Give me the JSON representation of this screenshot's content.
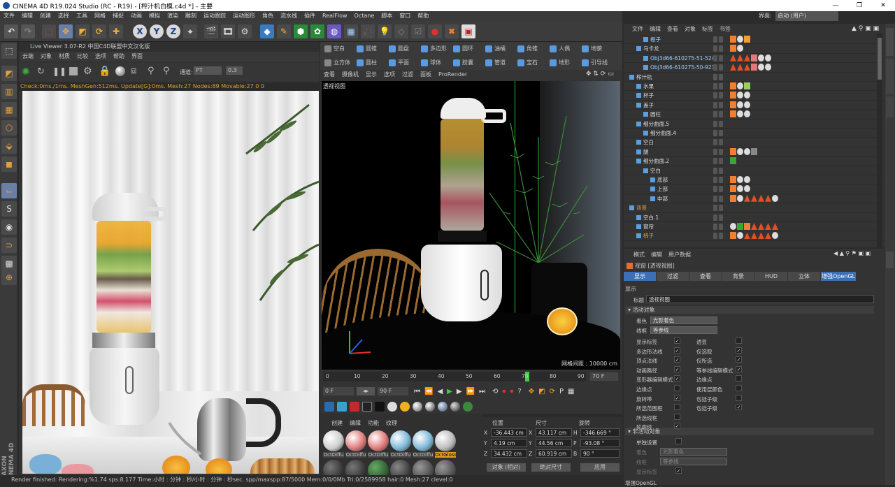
{
  "window": {
    "title": "CINEMA 4D R19.024 Studio (RC - R19) - [榨汁机白模.c4d *] - 主要",
    "layout_label": "界面:",
    "layout_value": "启动 (用户)"
  },
  "menu": [
    "文件",
    "编辑",
    "创建",
    "选择",
    "工具",
    "网格",
    "捕捉",
    "动画",
    "模拟",
    "渲染",
    "雕刻",
    "运动跟踪",
    "运动图形",
    "角色",
    "流水线",
    "插件",
    "RealFlow",
    "Octane",
    "脚本",
    "窗口",
    "帮助"
  ],
  "liveviewer": {
    "title": "Live Viewer 3.07-R2 中国C4D联盟中文汉化版",
    "menu": [
      "云端",
      "对象",
      "材质",
      "比较",
      "选项",
      "帮助",
      "界面"
    ],
    "channel_label": "通道:",
    "channel_value": "PT",
    "value_field": "0.3",
    "status": "Check:0ms./1ms. MeshGen:512ms. Update[G]:0ms. Mesh:27 Nodes:89 Movable:27  0 0"
  },
  "viewport": {
    "toolbar_row1": [
      "空白",
      "圆锥",
      "圆盘",
      "多边形",
      "圆环",
      "油桶",
      "角锥",
      "人偶",
      "地貌"
    ],
    "toolbar_row2": [
      "立方体",
      "圆柱",
      "平面",
      "球体",
      "胶囊",
      "管道",
      "宝石",
      "地形",
      "引导线"
    ],
    "menu": [
      "查看",
      "摄像机",
      "显示",
      "选项",
      "过滤",
      "面板",
      "ProRender"
    ],
    "label": "透视视图",
    "grid_distance": "网格间距 : 10000 cm"
  },
  "timeline": {
    "ticks": [
      "0",
      "10",
      "20",
      "30",
      "40",
      "50",
      "60",
      "70",
      "80",
      "90"
    ],
    "current": "70",
    "fps_field": "70 F",
    "start_field": "0 F",
    "end_field": "90 F"
  },
  "materials": {
    "menu": [
      "创建",
      "编辑",
      "功能",
      "纹理"
    ],
    "items": [
      {
        "label": "OctDiffu",
        "color": "#cfcfcf"
      },
      {
        "label": "OctDiffu",
        "color": "#e07b7b"
      },
      {
        "label": "OctDiffu",
        "color": "#e07b7b"
      },
      {
        "label": "OctDiffu",
        "color": "#7fb8d8"
      },
      {
        "label": "OctDiffu",
        "color": "#7fb8d8"
      },
      {
        "label": "OctGloss",
        "color": "#bcbcbc"
      }
    ]
  },
  "coords": {
    "headers": [
      "位置",
      "尺寸",
      "旋转"
    ],
    "rows": [
      {
        "axis": "X",
        "pos": "-36.443 cm",
        "size_axis": "X",
        "size": "43.117 cm",
        "rot_axis": "H",
        "rot": "-346.669 °"
      },
      {
        "axis": "Y",
        "pos": "4.19 cm",
        "size_axis": "Y",
        "size": "44.56 cm",
        "rot_axis": "P",
        "rot": "-93.08 °"
      },
      {
        "axis": "Z",
        "pos": "34.432 cm",
        "size_axis": "Z",
        "size": "60.919 cm",
        "rot_axis": "B",
        "rot": "90 °"
      }
    ],
    "mode1": "对象 (相对)",
    "mode2": "绝对尺寸",
    "apply": "应用"
  },
  "statusbar": "Render finished: Rendering:%1.74 sps:8.177 Time:小时 : 分钟 : 秒/小时 : 分钟 : 秒sec. spp/maxspp:87/5000 Mem:0/0/0Mb Tri:0/2589958 hair:0 Mesh:27 clevel:0",
  "objmgr": {
    "menu": [
      "文件",
      "编辑",
      "查看",
      "对象",
      "标签",
      "书签"
    ],
    "rows": [
      {
        "name": "橙子",
        "indent": 2,
        "color": "#9fd0ff"
      },
      {
        "name": "马卡龙",
        "indent": 1,
        "color": "#ddd"
      },
      {
        "name": "Obj3d66-610275-51-524",
        "indent": 2,
        "color": "#9fd0ff"
      },
      {
        "name": "Obj3d66-610275-50-923",
        "indent": 2,
        "color": "#9fd0ff"
      },
      {
        "name": "榨汁机",
        "indent": 0,
        "color": "#ddd"
      },
      {
        "name": "水果",
        "indent": 1,
        "color": "#ddd"
      },
      {
        "name": "杯子",
        "indent": 1,
        "color": "#ddd"
      },
      {
        "name": "盖子",
        "indent": 1,
        "color": "#ddd"
      },
      {
        "name": "圆柱",
        "indent": 2,
        "color": "#ddd"
      },
      {
        "name": "细分曲面.5",
        "indent": 1,
        "color": "#ddd"
      },
      {
        "name": "细分曲面.4",
        "indent": 2,
        "color": "#ddd"
      },
      {
        "name": "空白",
        "indent": 1,
        "color": "#ddd"
      },
      {
        "name": "腿",
        "indent": 1,
        "color": "#ddd"
      },
      {
        "name": "细分曲面.2",
        "indent": 1,
        "color": "#ddd"
      },
      {
        "name": "空白",
        "indent": 2,
        "color": "#ddd"
      },
      {
        "name": "底部",
        "indent": 3,
        "color": "#ddd"
      },
      {
        "name": "上部",
        "indent": 3,
        "color": "#ddd"
      },
      {
        "name": "中部",
        "indent": 3,
        "color": "#ddd"
      },
      {
        "name": "背景",
        "indent": 0,
        "color": "#e0a040"
      },
      {
        "name": "空白.1",
        "indent": 1,
        "color": "#ddd"
      },
      {
        "name": "窗帘",
        "indent": 1,
        "color": "#ddd"
      },
      {
        "name": "椅子",
        "indent": 1,
        "color": "#e0a040"
      }
    ]
  },
  "attrmgr": {
    "menu": [
      "模式",
      "编辑",
      "用户数据"
    ],
    "header": "视窗 [透视视图]",
    "tabs": [
      "显示",
      "过滤",
      "查看",
      "背景",
      "HUD",
      "立体",
      "增强OpenGL"
    ],
    "section": "显示",
    "title_label": "标题",
    "title_value": "透视视图",
    "group1": "活动对象",
    "shading_label": "着色",
    "shading_value": "光影着色",
    "lines_label": "线框",
    "lines_value": "等参线",
    "left_opts": [
      {
        "label": "显示标签",
        "on": true
      },
      {
        "label": "多边形法线",
        "on": true
      },
      {
        "label": "顶点法线",
        "on": true
      },
      {
        "label": "动画路径",
        "on": true
      },
      {
        "label": "变形器编辑模式",
        "on": true
      },
      {
        "label": "边缘点",
        "on": false
      },
      {
        "label": "旋转带",
        "on": true
      },
      {
        "label": "所选范围框",
        "on": false
      },
      {
        "label": "所选线框",
        "on": false
      },
      {
        "label": "轮廓线",
        "on": true
      }
    ],
    "right_opts": [
      {
        "label": "透显",
        "on": false
      },
      {
        "label": "仅选取",
        "on": true
      },
      {
        "label": "仅所选",
        "on": true
      },
      {
        "label": "等参线编辑模式",
        "on": true
      },
      {
        "label": "边缘点",
        "on": false
      },
      {
        "label": "使用层颜色",
        "on": false
      },
      {
        "label": "包括子级",
        "on": false
      },
      {
        "label": "包括子级",
        "on": true
      }
    ],
    "group2": "非活动对象",
    "single_label": "单独设置",
    "shading2_label": "着色",
    "shading2_value": "光影着色",
    "lines2_label": "线框",
    "lines2_value": "等参线",
    "show_tags": "显示标签",
    "enhanced": "增强OpenGL"
  }
}
